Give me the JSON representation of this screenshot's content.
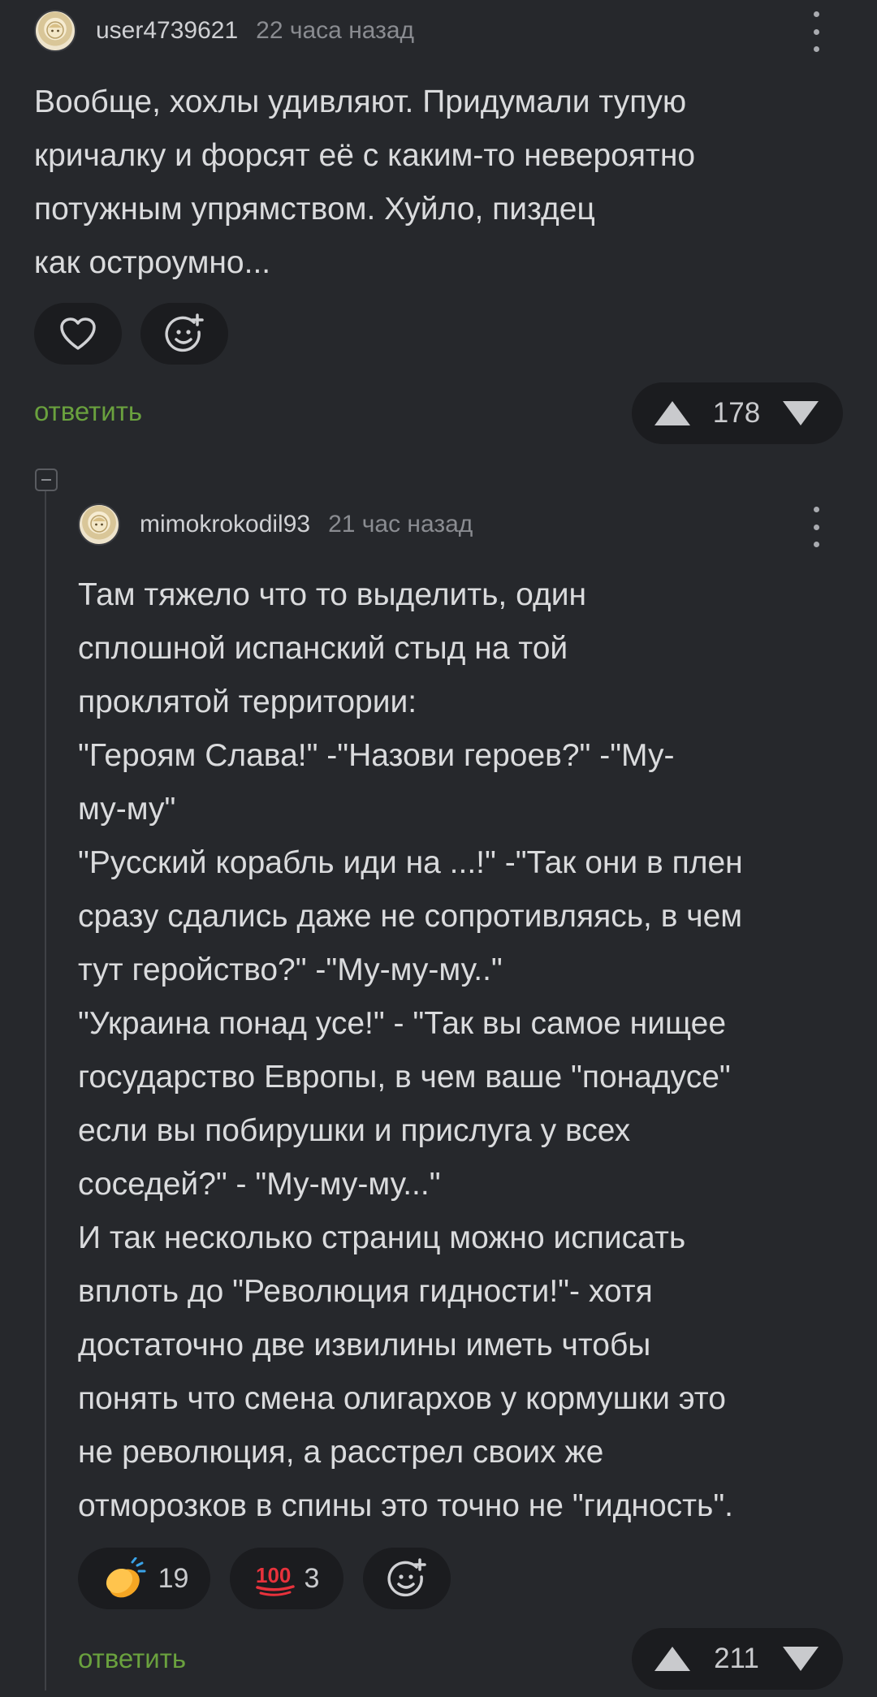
{
  "comments": [
    {
      "username": "user4739621",
      "time": "22 часа назад",
      "text": "Вообще, хохлы удивляют. Придумали тупую\nкричалку и форсят её с каким-то невероятно\nпотужным упрямством. Хуйло, пиздец\nкак остроумно...",
      "reply": "ответить",
      "score": "178"
    },
    {
      "username": "mimokrokodil93",
      "time": "21 час назад",
      "text": "Там тяжело что то выделить, один\nсплошной испанский стыд на той\nпроклятой территории:\n\"Героям Слава!\" -\"Назови героев?\" -\"Му-\nму-му\"\n\"Русский корабль иди на ...!\" -\"Так они в плен\nсразу сдались даже не сопротивляясь, в чем\nтут геройство?\" -\"Му-му-му..\"\n\"Украина понад усе!\" - \"Так вы самое нищее\nгосударство Европы, в чем ваше \"понадусе\"\nесли вы побирушки и прислуга у всех\nсоседей?\" - \"Му-му-му...\"\nИ так несколько страниц можно исписать\nвплоть до \"Революция гидности!\"- хотя\nдостаточно две извилины иметь чтобы\nпонять что смена олигархов у кормушки это\nне революция, а расстрел своих же\nотморозков в спины это точно не \"гидность\".",
      "reactions": [
        {
          "icon": "clapping-hands-emoji",
          "count": "19"
        },
        {
          "icon": "hundred-points-emoji",
          "count": "3"
        }
      ],
      "reply": "ответить",
      "score": "211"
    }
  ],
  "icons": {
    "like": "heart-icon",
    "add_reaction": "add-reaction-icon",
    "upvote": "upvote-arrow-icon",
    "downvote": "downvote-arrow-icon",
    "more": "more-options-icon",
    "collapse": "collapse-thread-icon"
  },
  "colors": {
    "background": "#26282c",
    "text": "#dadbdd",
    "muted": "#8a8c91",
    "reply_link": "#6aa13e",
    "pill": "#1b1c1f"
  }
}
